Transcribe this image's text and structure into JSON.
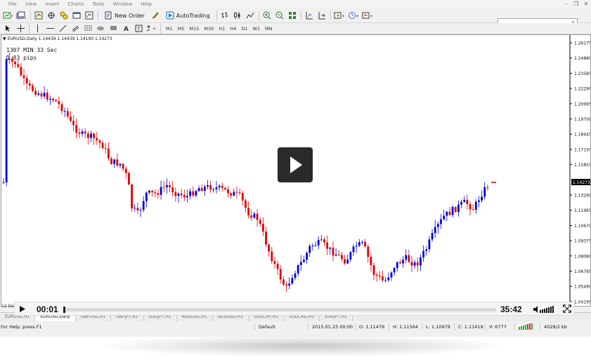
{
  "menu": [
    "File",
    "View",
    "Insert",
    "Charts",
    "Tools",
    "Window",
    "Help"
  ],
  "toolbar": {
    "new_order_label": "New Order",
    "autotrading_label": "AutoTrading"
  },
  "timeframes": [
    "M1",
    "M5",
    "M15",
    "M30",
    "H1",
    "H4",
    "D1",
    "W1",
    "MN"
  ],
  "chart": {
    "header": "EURUSD,Daily  1.14439 1.14439 1.14190 1.14273",
    "overlay_line1": "1307 MIN 33 Sec",
    "overlay_line2": "1.83 pips",
    "price_ticks": [
      "1.26175",
      "1.24880",
      "1.23585",
      "1.22290",
      "1.20995",
      "1.19700",
      "1.18445",
      "1.17150",
      "1.15855",
      "1.14273",
      "1.13260",
      "1.11965",
      "1.10670",
      "1.09375",
      "1.08080",
      "1.06785",
      "1.05490",
      "1.04195"
    ],
    "current_price": "1.14273",
    "date_label": "12 Dec",
    "colors": {
      "bull": "#0000dd",
      "bear": "#dd0000",
      "price_tag": "#000000"
    }
  },
  "tabs": [
    "EURUSD,H1",
    "EURUSD,Daily",
    "GBPUSD,H1",
    "GBPJPY,H1",
    "USDJPY,H1",
    "AUDUSD,H1",
    "NZDUSD,H1",
    "USDCHF,H1",
    "USDCAD,H1",
    "EURJPY,H1"
  ],
  "active_tab": 1,
  "status": {
    "help": "For Help, press F1",
    "profile": "Default",
    "datetime": "2015.01.25 00:00",
    "open": "O: 1.11479",
    "high": "H: 1.11564",
    "low": "L: 1.10979",
    "close": "C: 1.11419",
    "volume": "V: 6777",
    "traffic": "4029/2 kb"
  },
  "player": {
    "elapsed": "00:01",
    "remaining": "35:42",
    "progress": 0.002
  }
}
